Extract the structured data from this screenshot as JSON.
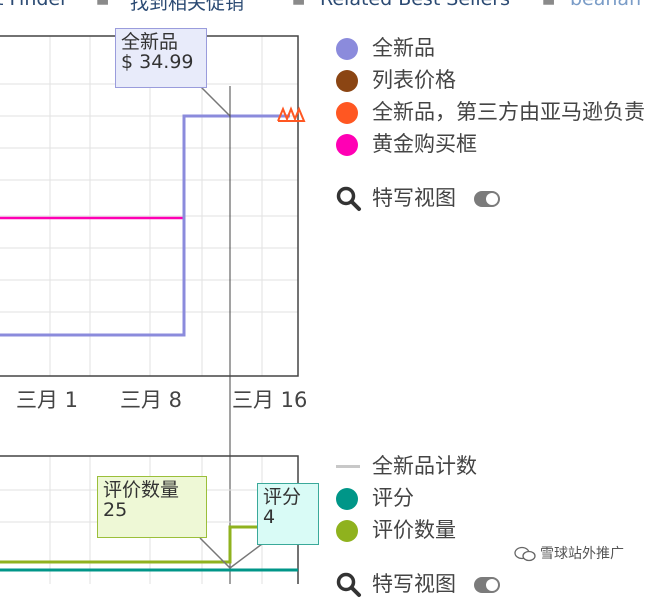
{
  "nav": {
    "items": [
      "t Finder",
      "找到相关促销",
      "Related Best Sellers",
      "beanan"
    ],
    "separator": "■"
  },
  "chart_data": [
    {
      "type": "line",
      "x_tick_labels": [
        "三月 1",
        "三月 8",
        "三月 16"
      ],
      "series": [
        {
          "name": "全新品",
          "color": "#8b8bdc"
        },
        {
          "name": "列表价格",
          "color": "#8b4513"
        },
        {
          "name": "全新品，第三方由亚马逊负责",
          "color": "#ff5722"
        },
        {
          "name": "黄金购买框",
          "color": "#ff00b4"
        }
      ],
      "tooltip": {
        "title": "全新品",
        "value": "$ 34.99"
      },
      "grid": true
    },
    {
      "type": "line",
      "series": [
        {
          "name": "全新品计数",
          "color": "#c8c8c8"
        },
        {
          "name": "评分",
          "color": "#009688"
        },
        {
          "name": "评价数量",
          "color": "#8fb21e"
        }
      ],
      "tooltips": [
        {
          "title": "评价数量",
          "value": "25"
        },
        {
          "title": "评分",
          "value": "4"
        }
      ],
      "grid": true
    }
  ],
  "legend_top": [
    {
      "label": "全新品",
      "color": "#8b8bdc"
    },
    {
      "label": "列表价格",
      "color": "#8b4513"
    },
    {
      "label": "全新品，第三方由亚马逊负责",
      "color": "#ff5722"
    },
    {
      "label": "黄金购买框",
      "color": "#ff00b4"
    }
  ],
  "legend_bottom": [
    {
      "label": "全新品计数",
      "color": "#c8c8c8"
    },
    {
      "label": "评分",
      "color": "#009688"
    },
    {
      "label": "评价数量",
      "color": "#8fb21e"
    }
  ],
  "zoom": {
    "label": "特写视图"
  },
  "watermark": {
    "text": "雪球站外推广"
  }
}
